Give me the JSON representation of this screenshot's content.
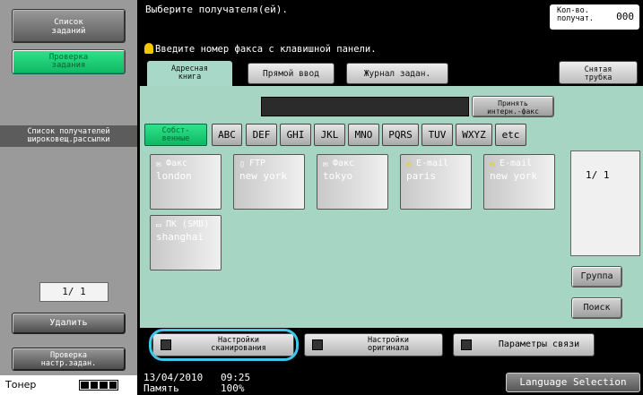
{
  "left_panel": {
    "job_list": "Список\nзаданий",
    "check_job": "Проверка\nзадания",
    "broadcast_list": "Список получателей\nшироковещ.рассылки",
    "page_indicator": "1/ 1",
    "delete": "Удалить",
    "check_job_settings": "Проверка\nнастр.задан.",
    "toner_label": "Тонер",
    "toner_level": 1.0
  },
  "header": {
    "message": "Выберите получателя(ей).",
    "recipients_label": "Кол-во.\nполучат.",
    "recipients_count": "000",
    "hint": "Введите номер факса с клавишной панели."
  },
  "tabs": {
    "address_book": "Адресная\nкнига",
    "direct_input": "Прямой ввод",
    "job_log": "Журнал задан.",
    "off_hook": "Снятая\nтрубка"
  },
  "internet_fax": "Принять\nинтерн.-факс",
  "alpha_tabs": [
    "Собст-\nвенные",
    "ABC",
    "DEF",
    "GHI",
    "JKL",
    "MNO",
    "PQRS",
    "TUV",
    "WXYZ",
    "etc"
  ],
  "destinations": [
    {
      "type": "Факс",
      "name": "london",
      "icon": "fax-icon"
    },
    {
      "type": "FTP",
      "name": "new york",
      "icon": "ftp-icon"
    },
    {
      "type": "Факс",
      "name": "tokyo",
      "icon": "fax-icon"
    },
    {
      "type": "E-mail",
      "name": "paris",
      "icon": "mail-icon"
    },
    {
      "type": "E-mail",
      "name": "new york",
      "icon": "mail-icon"
    },
    {
      "type": "ПК (SMB)",
      "name": "shanghai",
      "icon": "pc-icon"
    }
  ],
  "dest_page": "1/  1",
  "group": "Группа",
  "search": "Поиск",
  "bottom": {
    "scan_settings": "Настройки\nсканирования",
    "original_settings": "Настройки\nоригинала",
    "comm_settings": "Параметры связи"
  },
  "status": {
    "date": "13/04/2010",
    "time": "09:25",
    "memory_label": "Память",
    "memory_value": "100%",
    "language": "Language Selection"
  }
}
